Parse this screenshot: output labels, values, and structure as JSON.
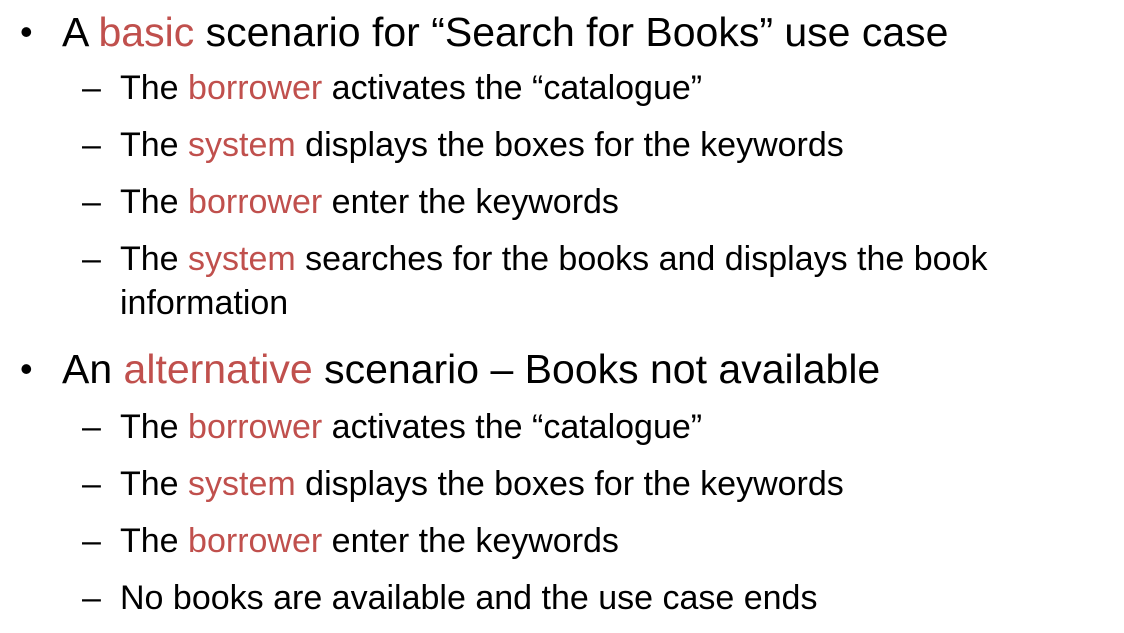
{
  "bullet_symbol": "•",
  "dash_symbol": "–",
  "highlight_color": "#c0504d",
  "basic": {
    "prefix": "A ",
    "highlight": "basic",
    "suffix": " scenario for “Search for Books” use case",
    "steps": [
      {
        "prefix": "The ",
        "highlight": "borrower",
        "suffix": " activates the “catalogue”"
      },
      {
        "prefix": "The ",
        "highlight": "system",
        "suffix": " displays the boxes for the keywords"
      },
      {
        "prefix": "The ",
        "highlight": "borrower",
        "suffix": " enter the keywords"
      },
      {
        "prefix": "The ",
        "highlight": "system",
        "suffix": " searches for the books and displays the book",
        "continuation": "information"
      }
    ]
  },
  "alternative": {
    "prefix": "An ",
    "highlight": "alternative",
    "suffix": " scenario – Books not available",
    "steps": [
      {
        "prefix": "The ",
        "highlight": "borrower",
        "suffix": " activates the “catalogue”"
      },
      {
        "prefix": "The ",
        "highlight": "system",
        "suffix": " displays the boxes for the keywords"
      },
      {
        "prefix": "The ",
        "highlight": "borrower",
        "suffix": " enter the keywords"
      },
      {
        "prefix": "No books are available and the use case ends",
        "highlight": "",
        "suffix": ""
      }
    ]
  }
}
